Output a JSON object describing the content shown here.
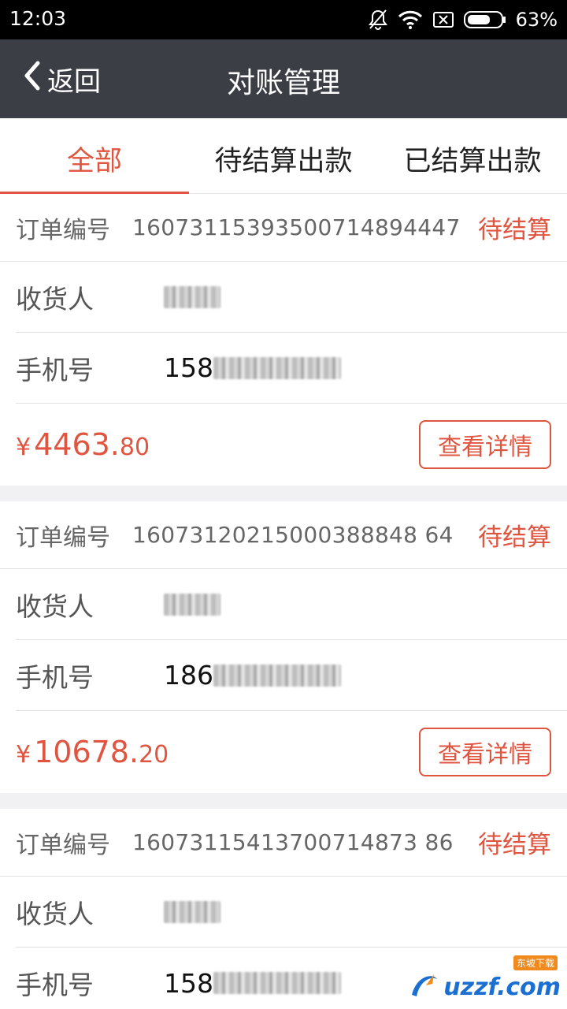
{
  "status_bar": {
    "time": "12:03",
    "battery_percent": "63%",
    "icons": [
      "bell-off-icon",
      "wifi-icon",
      "sim-x-icon",
      "battery-icon"
    ]
  },
  "header": {
    "back_label": "返回",
    "title": "对账管理"
  },
  "tabs": [
    {
      "label": "全部",
      "active": true
    },
    {
      "label": "待结算出款",
      "active": false
    },
    {
      "label": "已结算出款",
      "active": false
    }
  ],
  "labels": {
    "order_no": "订单编号",
    "receiver": "收货人",
    "phone": "手机号",
    "detail_button": "查看详情"
  },
  "orders": [
    {
      "order_no": "16073115393500714894447",
      "status": "待结算",
      "phone_prefix": "158",
      "amount_currency": "¥",
      "amount_int": "4463.",
      "amount_dec": "80"
    },
    {
      "order_no": "16073120215000388848 64",
      "status": "待结算",
      "phone_prefix": "186",
      "amount_currency": "¥",
      "amount_int": "10678.",
      "amount_dec": "20"
    },
    {
      "order_no": "16073115413700714873 86",
      "status": "待结算",
      "phone_prefix": "158"
    }
  ],
  "watermark": {
    "text": "uzzf.com",
    "badge": "东坡下载"
  },
  "colors": {
    "accent": "#e0553f",
    "header_bg": "#3b3f45",
    "separator": "#f1f1f3"
  }
}
